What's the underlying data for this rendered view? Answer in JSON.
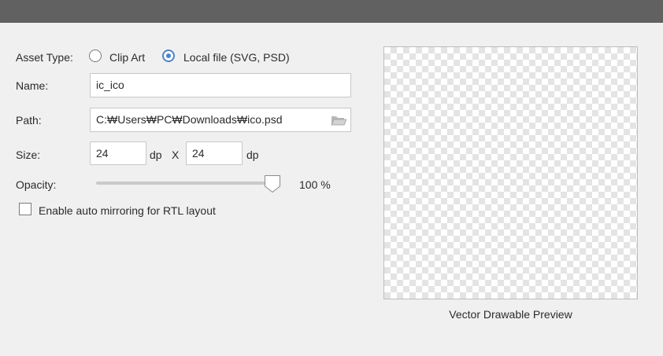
{
  "form": {
    "asset_type_label": "Asset Type:",
    "asset_type_options": [
      "Clip Art",
      "Local file (SVG, PSD)"
    ],
    "asset_type_selected": "Local file (SVG, PSD)",
    "name_label": "Name:",
    "name_value": "ic_ico",
    "path_label": "Path:",
    "path_value": "C:₩Users₩PC₩Downloads₩ico.psd",
    "size_label": "Size:",
    "width_value": "24",
    "width_unit": "dp",
    "size_separator": "X",
    "height_value": "24",
    "height_unit": "dp",
    "opacity_label": "Opacity:",
    "opacity_value": "100 %",
    "opacity_fraction": 1.0,
    "auto_mirror_label": "Enable auto mirroring for RTL layout",
    "auto_mirror_checked": false
  },
  "preview": {
    "caption": "Vector Drawable Preview"
  },
  "colors": {
    "accent": "#4a86c8",
    "titlebar": "#616161",
    "background": "#f0f0f0"
  },
  "icons": {
    "browse": "folder-icon"
  }
}
